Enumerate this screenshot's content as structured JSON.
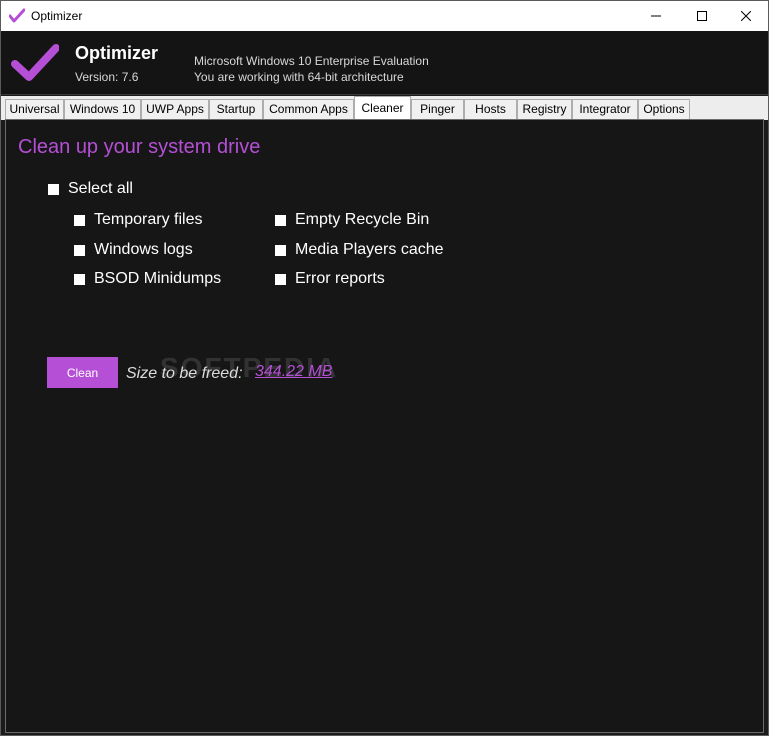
{
  "window": {
    "title": "Optimizer",
    "icon": "checkmark-icon",
    "controls": [
      "minimize-icon",
      "maximize-icon",
      "close-icon"
    ]
  },
  "header": {
    "app_name": "Optimizer",
    "version": "Version: 7.6",
    "os_info": "Microsoft Windows 10 Enterprise Evaluation",
    "arch_info": "You are working with 64-bit architecture",
    "logo_icon": "checkmark-icon",
    "accent_color": "#b54fd6"
  },
  "tabs": [
    {
      "label": "Universal"
    },
    {
      "label": "Windows 10"
    },
    {
      "label": "UWP Apps"
    },
    {
      "label": "Startup"
    },
    {
      "label": "Common Apps"
    },
    {
      "label": "Cleaner"
    },
    {
      "label": "Pinger"
    },
    {
      "label": "Hosts"
    },
    {
      "label": "Registry"
    },
    {
      "label": "Integrator"
    },
    {
      "label": "Options"
    }
  ],
  "active_tab": "Cleaner",
  "cleaner": {
    "heading": "Clean up your system drive",
    "select_all": "Select all",
    "options": [
      {
        "label": "Temporary files",
        "checked": false
      },
      {
        "label": "Windows logs",
        "checked": false
      },
      {
        "label": "BSOD Minidumps",
        "checked": false
      },
      {
        "label": "Empty Recycle Bin",
        "checked": false
      },
      {
        "label": "Media Players cache",
        "checked": false
      },
      {
        "label": "Error reports",
        "checked": false
      }
    ],
    "clean_button": "Clean",
    "size_label": "Size to be freed:",
    "size_value": "344.22 MB",
    "watermark": "SOFTPEDIA"
  }
}
